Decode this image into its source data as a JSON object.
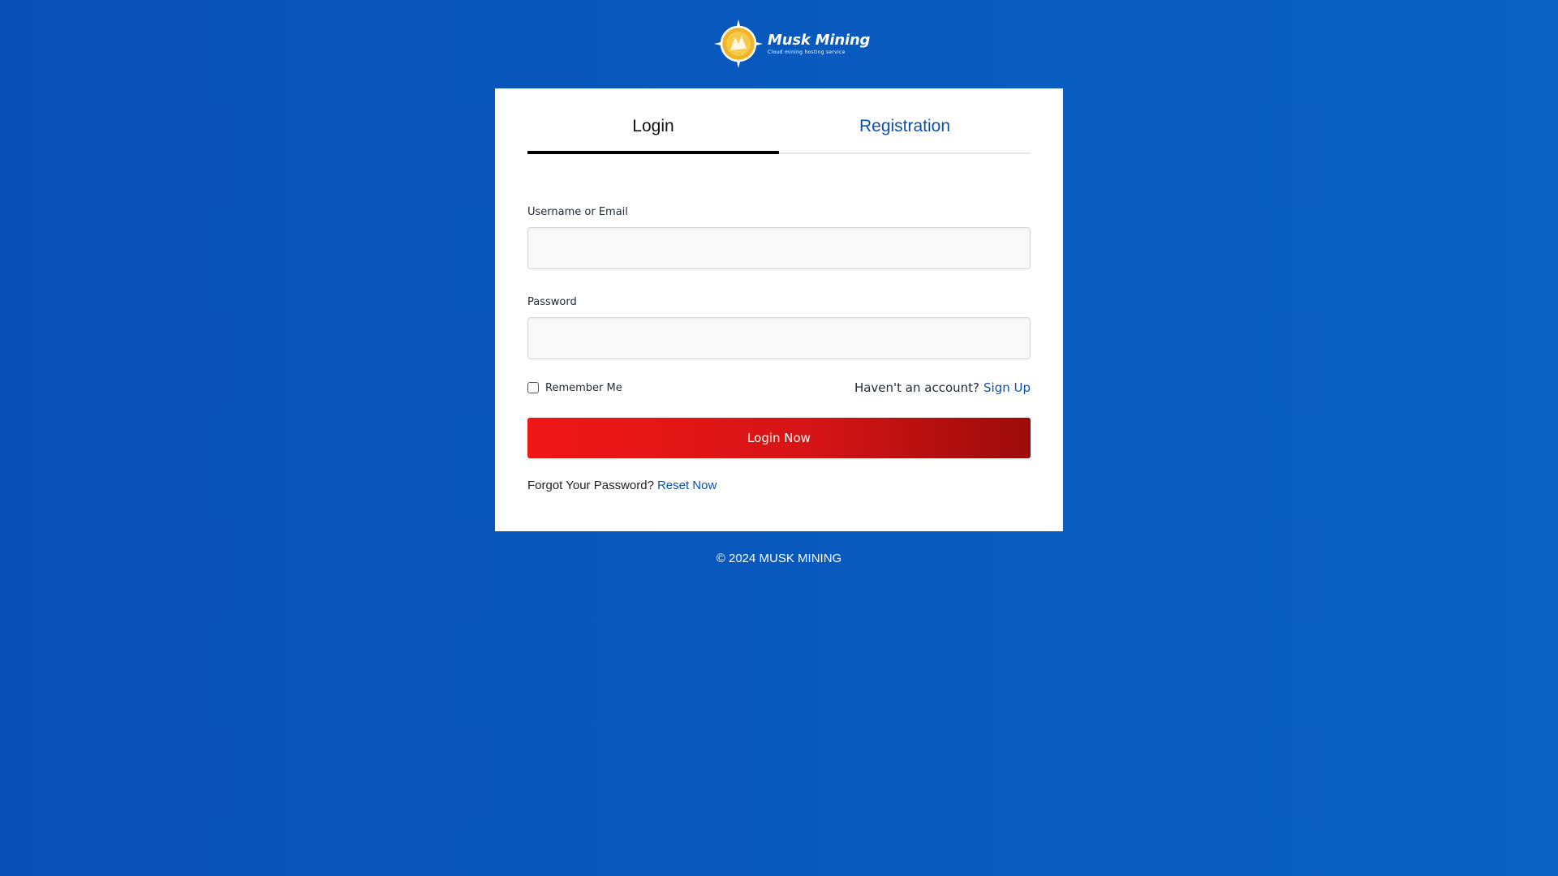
{
  "brand": {
    "name": "Musk Mining",
    "tagline": "Cloud mining hosting service",
    "colors": {
      "background": "#0858be",
      "accent_link": "#0b52ad",
      "button": "#d71516",
      "logo_gold": "#f0b429"
    }
  },
  "tabs": [
    {
      "label": "Login",
      "active": true
    },
    {
      "label": "Registration",
      "active": false
    }
  ],
  "form": {
    "username_label": "Username or Email",
    "username_value": "",
    "password_label": "Password",
    "password_value": "",
    "remember_label": "Remember Me",
    "remember_checked": false,
    "no_account_text": "Haven't an account?",
    "signup_link": "Sign Up",
    "submit_label": "Login Now",
    "forgot_text": "Forgot Your Password?",
    "reset_link": "Reset Now"
  },
  "footer": {
    "copyright": "© 2024 MUSK MINING"
  },
  "icons": {
    "logo": "musk-mining-logo-icon",
    "checkbox": "checkbox-icon"
  }
}
